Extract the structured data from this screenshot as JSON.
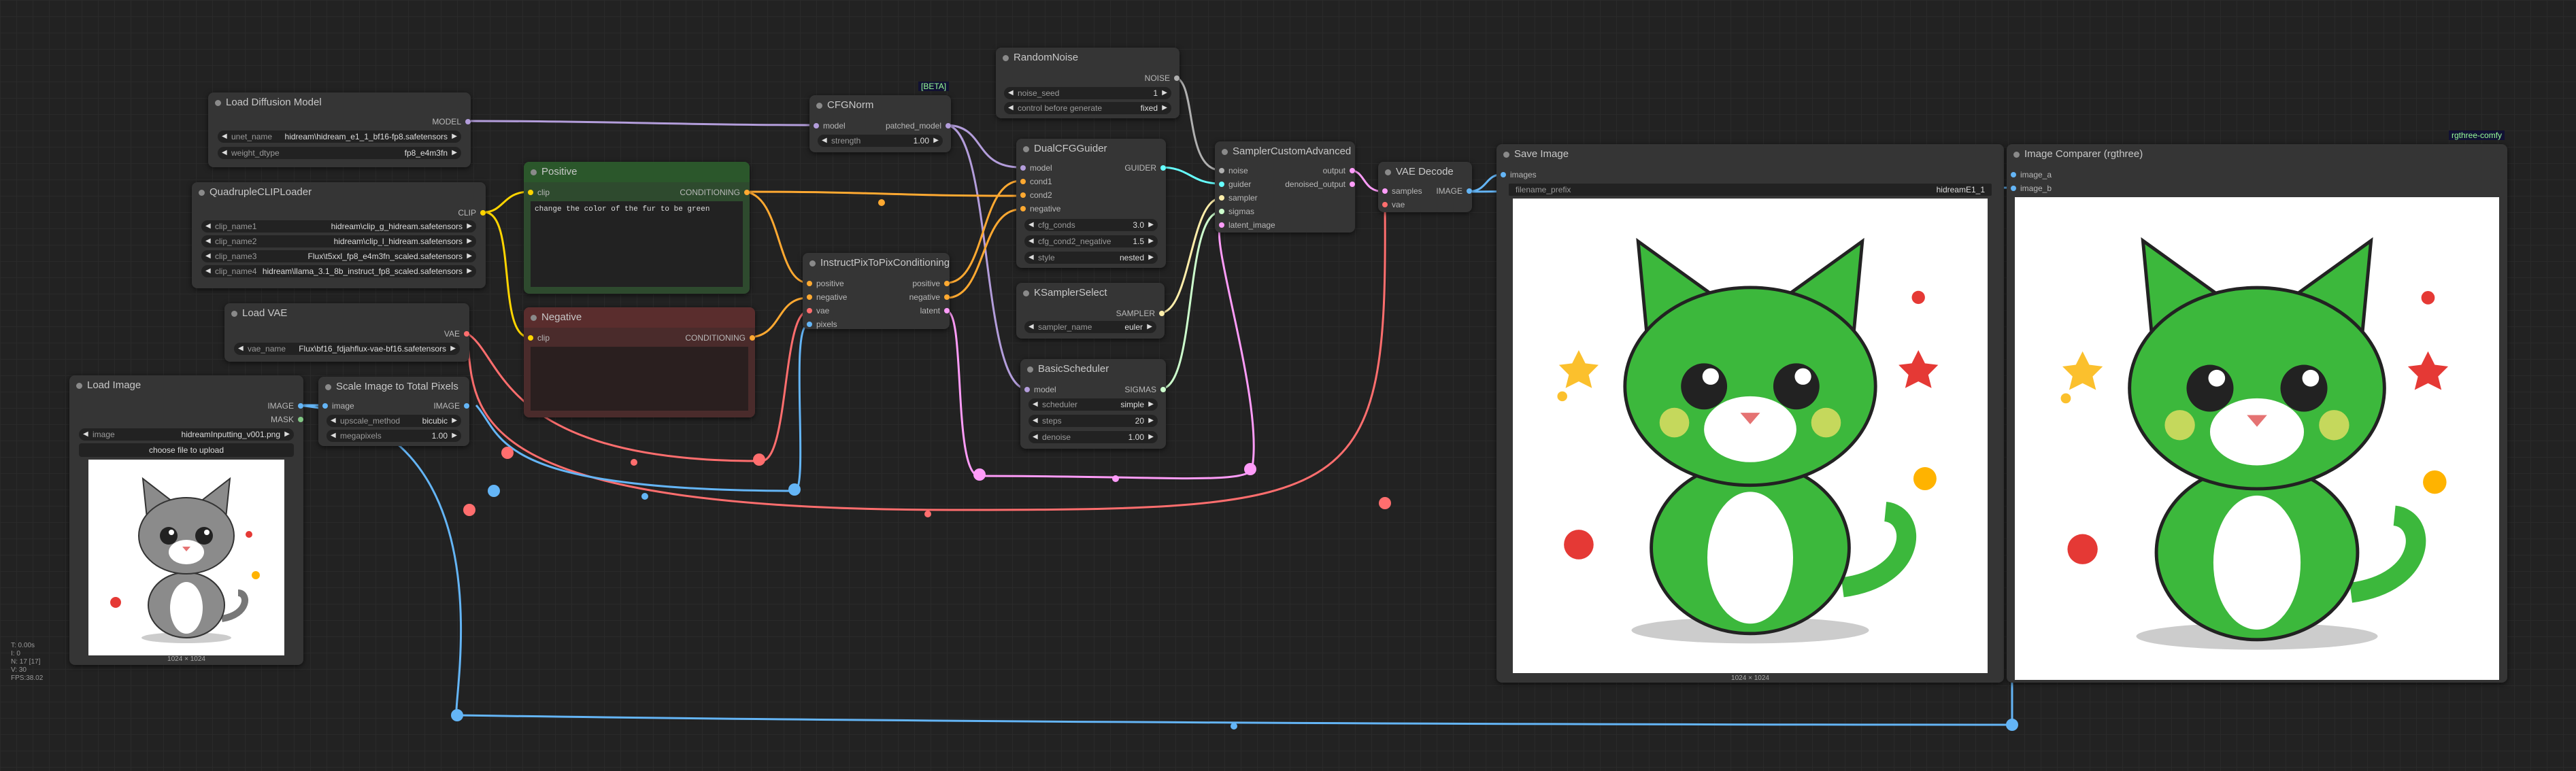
{
  "badges": {
    "beta": "[BETA]",
    "rgthree": "rgthree-comfy"
  },
  "stats": [
    "T: 0.00s",
    "I: 0",
    "N: 17 [17]",
    "V: 30",
    "FPS:38.02"
  ],
  "colors": {
    "model": "#b39ddb",
    "clip": "#ffd500",
    "conditioning": "#ffa931",
    "vae": "#ff6e6e",
    "image": "#64b5f6",
    "latent": "#ff9cf9",
    "noise": "#b0b0b0",
    "guider": "#66ffff",
    "sampler": "#ffeeaa",
    "sigmas": "#cdffcd"
  },
  "load_diffusion": {
    "title": "Load Diffusion Model",
    "out_model": "MODEL",
    "unet_label": "unet_name",
    "unet_value": "hidream\\hidream_e1_1_bf16-fp8.safetensors",
    "dtype_label": "weight_dtype",
    "dtype_value": "fp8_e4m3fn"
  },
  "quad_clip": {
    "title": "QuadrupleCLIPLoader",
    "out_clip": "CLIP",
    "rows": [
      {
        "label": "clip_name1",
        "value": "hidream\\clip_g_hidream.safetensors"
      },
      {
        "label": "clip_name2",
        "value": "hidream\\clip_l_hidream.safetensors"
      },
      {
        "label": "clip_name3",
        "value": "Flux\\t5xxl_fp8_e4m3fn_scaled.safetensors"
      },
      {
        "label": "clip_name4",
        "value": "hidream\\llama_3.1_8b_instruct_fp8_scaled.safetensors"
      }
    ]
  },
  "load_vae": {
    "title": "Load VAE",
    "out_vae": "VAE",
    "vae_label": "vae_name",
    "vae_value": "Flux\\bf16_fdjahflux-vae-bf16.safetensors"
  },
  "load_image": {
    "title": "Load Image",
    "out_image": "IMAGE",
    "out_mask": "MASK",
    "image_label": "image",
    "image_value": "hidreamInputting_v001.png",
    "upload": "choose file to upload",
    "size": "1024 × 1024"
  },
  "scale_image": {
    "title": "Scale Image to Total Pixels",
    "in_image": "image",
    "out_image": "IMAGE",
    "method_label": "upscale_method",
    "method_value": "bicubic",
    "mp_label": "megapixels",
    "mp_value": "1.00"
  },
  "positive": {
    "title": "Positive",
    "in_clip": "clip",
    "out": "CONDITIONING",
    "text": "change the color of the fur to be green"
  },
  "negative": {
    "title": "Negative",
    "in_clip": "clip",
    "out": "CONDITIONING",
    "text": ""
  },
  "cfgnorm": {
    "title": "CFGNorm",
    "in_model": "model",
    "out_model": "patched_model",
    "strength_label": "strength",
    "strength_value": "1.00"
  },
  "instruct": {
    "title": "InstructPixToPixConditioning",
    "in_pos": "positive",
    "in_neg": "negative",
    "in_vae": "vae",
    "in_pixels": "pixels",
    "out_pos": "positive",
    "out_neg": "negative",
    "out_latent": "latent"
  },
  "random_noise": {
    "title": "RandomNoise",
    "out_noise": "NOISE",
    "seed_label": "noise_seed",
    "seed_value": "1",
    "control_label": "control before generate",
    "control_value": "fixed"
  },
  "dual_cfg": {
    "title": "DualCFGGuider",
    "in_model": "model",
    "in_cond1": "cond1",
    "in_cond2": "cond2",
    "in_neg": "negative",
    "out": "GUIDER",
    "cfg_label": "cfg_conds",
    "cfg_value": "3.0",
    "cfg2_label": "cfg_cond2_negative",
    "cfg2_value": "1.5",
    "style_label": "style",
    "style_value": "nested"
  },
  "ksampler_select": {
    "title": "KSamplerSelect",
    "out": "SAMPLER",
    "name_label": "sampler_name",
    "name_value": "euler"
  },
  "basic_sched": {
    "title": "BasicScheduler",
    "in_model": "model",
    "out": "SIGMAS",
    "sched_label": "scheduler",
    "sched_value": "simple",
    "steps_label": "steps",
    "steps_value": "20",
    "denoise_label": "denoise",
    "denoise_value": "1.00"
  },
  "sampler_adv": {
    "title": "SamplerCustomAdvanced",
    "in_noise": "noise",
    "in_guider": "guider",
    "in_sampler": "sampler",
    "in_sigmas": "sigmas",
    "in_latent": "latent_image",
    "out_output": "output",
    "out_denoised": "denoised_output"
  },
  "vae_decode": {
    "title": "VAE Decode",
    "in_samples": "samples",
    "in_vae": "vae",
    "out_image": "IMAGE"
  },
  "save_image": {
    "title": "Save Image",
    "in_images": "images",
    "prefix_label": "filename_prefix",
    "prefix_value": "hidreamE1_1",
    "size": "1024 × 1024"
  },
  "comparer": {
    "title": "Image Comparer (rgthree)",
    "in_a": "image_a",
    "in_b": "image_b"
  }
}
